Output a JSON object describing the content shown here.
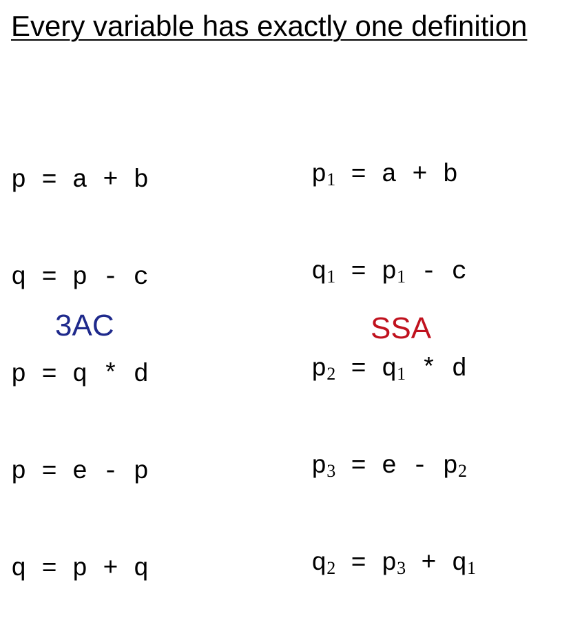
{
  "title": "Every variable has exactly one definition",
  "three_ac": {
    "label": "3AC",
    "label_color": "#1f2a8c",
    "lines": [
      {
        "lhs": "p",
        "op": "=",
        "a": "a",
        "oper": "+",
        "b": "b"
      },
      {
        "lhs": "q",
        "op": "=",
        "a": "p",
        "oper": "-",
        "b": "c"
      },
      {
        "lhs": "p",
        "op": "=",
        "a": "q",
        "oper": "*",
        "b": "d"
      },
      {
        "lhs": "p",
        "op": "=",
        "a": "e",
        "oper": "-",
        "b": "p"
      },
      {
        "lhs": "q",
        "op": "=",
        "a": "p",
        "oper": "+",
        "b": "q"
      }
    ]
  },
  "ssa": {
    "label": "SSA",
    "label_color": "#c0121e",
    "lines": [
      {
        "lhs": "p",
        "lhs_sub": "1",
        "op": "=",
        "a": "a",
        "a_sub": "",
        "oper": "+",
        "b": "b",
        "b_sub": ""
      },
      {
        "lhs": "q",
        "lhs_sub": "1",
        "op": "=",
        "a": "p",
        "a_sub": "1",
        "oper": "-",
        "b": "c",
        "b_sub": ""
      },
      {
        "lhs": "p",
        "lhs_sub": "2",
        "op": "=",
        "a": "q",
        "a_sub": "1",
        "oper": "*",
        "b": "d",
        "b_sub": ""
      },
      {
        "lhs": "p",
        "lhs_sub": "3",
        "op": "=",
        "a": "e",
        "a_sub": "",
        "oper": "-",
        "b": "p",
        "b_sub": "2"
      },
      {
        "lhs": "q",
        "lhs_sub": "2",
        "op": "=",
        "a": "p",
        "a_sub": "3",
        "oper": "+",
        "b": "q",
        "b_sub": "1"
      }
    ]
  }
}
